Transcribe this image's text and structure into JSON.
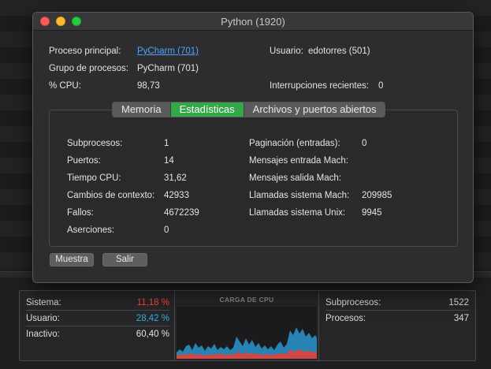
{
  "window": {
    "title": "Python (1920)"
  },
  "info": {
    "parent_label": "Proceso principal:",
    "parent_value": "PyCharm (701)",
    "group_label": "Grupo de procesos:",
    "group_value": "PyCharm (701)",
    "cpu_label": "% CPU:",
    "cpu_value": "98,73",
    "user_label": "Usuario:",
    "user_value": "edotorres (501)",
    "interrupts_label": "Interrupciones recientes:",
    "interrupts_value": "0"
  },
  "tabs": [
    {
      "label": "Memoria",
      "active": false
    },
    {
      "label": "Estadísticas",
      "active": true
    },
    {
      "label": "Archivos y puertos abiertos",
      "active": false
    }
  ],
  "stats_left": [
    {
      "label": "Subprocesos:",
      "value": "1"
    },
    {
      "label": "Puertos:",
      "value": "14"
    },
    {
      "label": "Tiempo CPU:",
      "value": "31,62"
    },
    {
      "label": "Cambios de contexto:",
      "value": "42933"
    },
    {
      "label": "Fallos:",
      "value": "4672239"
    },
    {
      "label": "Aserciones:",
      "value": "0"
    }
  ],
  "stats_right": [
    {
      "label": "Paginación (entradas):",
      "value": "0"
    },
    {
      "label": "Mensajes entrada Mach:",
      "value": ""
    },
    {
      "label": "Mensajes salida Mach:",
      "value": ""
    },
    {
      "label": "Llamadas sistema Mach:",
      "value": "209985"
    },
    {
      "label": "Llamadas sistema Unix:",
      "value": "9945"
    }
  ],
  "buttons": {
    "sample": "Muestra",
    "quit": "Salir"
  },
  "cpu_panel": {
    "left": [
      {
        "label": "Sistema:",
        "value": "11,18 %",
        "color": "#ff453a"
      },
      {
        "label": "Usuario:",
        "value": "28,42 %",
        "color": "#32ade6"
      },
      {
        "label": "Inactivo:",
        "value": "60,40 %",
        "color": "#e4e4e4"
      }
    ],
    "graph_title": "CARGA DE CPU",
    "right": [
      {
        "label": "Subprocesos:",
        "value": "1522"
      },
      {
        "label": "Procesos:",
        "value": "347"
      }
    ],
    "system_color": "#d9453f",
    "user_color": "#2a8fc7"
  }
}
